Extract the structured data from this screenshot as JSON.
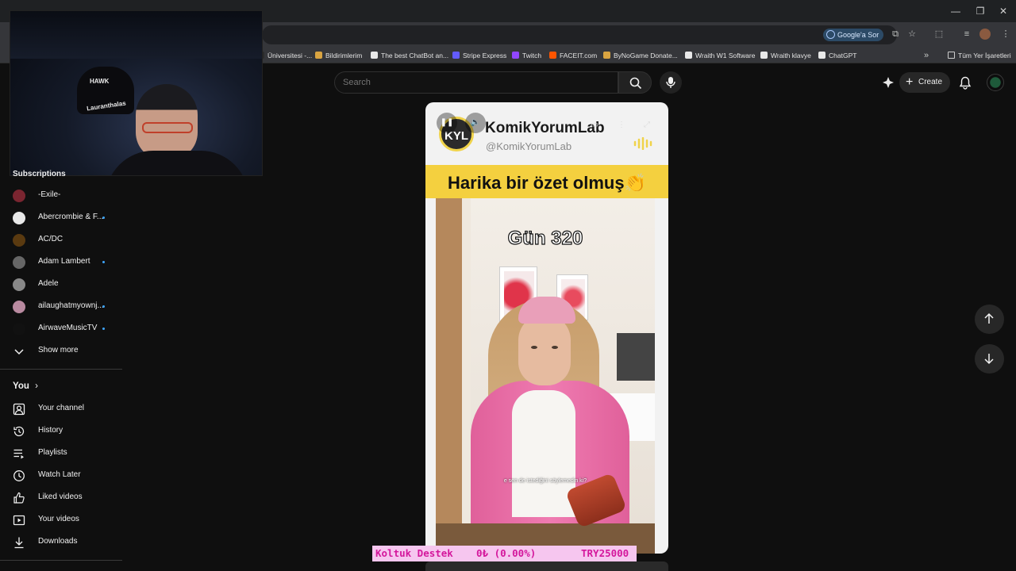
{
  "browser": {
    "google_sor_label": "Google'a Sor",
    "bookmarks": [
      {
        "label": "Üniversitesi -...",
        "color": "#2b2b2b"
      },
      {
        "label": "Bildirimlerim",
        "color": "#d9a441"
      },
      {
        "label": "The best ChatBot an...",
        "color": "#e8e8e8"
      },
      {
        "label": "Stripe Express",
        "color": "#635bff"
      },
      {
        "label": "Twitch",
        "color": "#9146ff"
      },
      {
        "label": "FACEIT.com",
        "color": "#ff5500"
      },
      {
        "label": "ByNoGame Donate...",
        "color": "#d9a441"
      },
      {
        "label": "Wraith W1 Software",
        "color": "#e8e8e8"
      },
      {
        "label": "Wraith klavye",
        "color": "#e8e8e8"
      },
      {
        "label": "ChatGPT",
        "color": "#e8e8e8"
      }
    ],
    "all_bookmarks_label": "Tüm Yer İşaretleri"
  },
  "webcam": {
    "cap_text_top": "HAWK",
    "cap_text_bottom": "Lauranthalas"
  },
  "header": {
    "search_placeholder": "Search",
    "create_label": "Create"
  },
  "sidebar": {
    "subscriptions_heading": "Subscriptions",
    "subscriptions": [
      {
        "label": "-Exile-",
        "new": false,
        "color": "#7a2530"
      },
      {
        "label": "Abercrombie & F...",
        "new": true,
        "color": "#e8e8e8"
      },
      {
        "label": "AC/DC",
        "new": false,
        "color": "#5a3a10"
      },
      {
        "label": "Adam Lambert",
        "new": true,
        "color": "#666"
      },
      {
        "label": "Adele",
        "new": false,
        "color": "#888"
      },
      {
        "label": "ailaughatmyownj...",
        "new": true,
        "color": "#b98aa0"
      },
      {
        "label": "AirwaveMusicTV",
        "new": true,
        "color": "#111"
      }
    ],
    "show_more_label": "Show more",
    "you_heading": "You",
    "you_items": [
      {
        "label": "Your channel",
        "icon": "person-icon"
      },
      {
        "label": "History",
        "icon": "history-icon"
      },
      {
        "label": "Playlists",
        "icon": "playlists-icon"
      },
      {
        "label": "Watch Later",
        "icon": "clock-icon"
      },
      {
        "label": "Liked videos",
        "icon": "thumb-up-icon"
      },
      {
        "label": "Your videos",
        "icon": "video-icon"
      },
      {
        "label": "Downloads",
        "icon": "download-icon"
      }
    ]
  },
  "short": {
    "channel_logo_text": "KYL",
    "channel_name": "KomikYorumLab",
    "channel_handle": "@KomikYorumLab",
    "banner_text": "Harika bir özet olmuş👏",
    "day_label": "Gün 320",
    "subtitle": "e sen de istediğini söylemedin ki?"
  },
  "ticker": {
    "label": "Koltuk Destek",
    "amount": "0₺ (0.00%)",
    "goal": "TRY25000"
  }
}
